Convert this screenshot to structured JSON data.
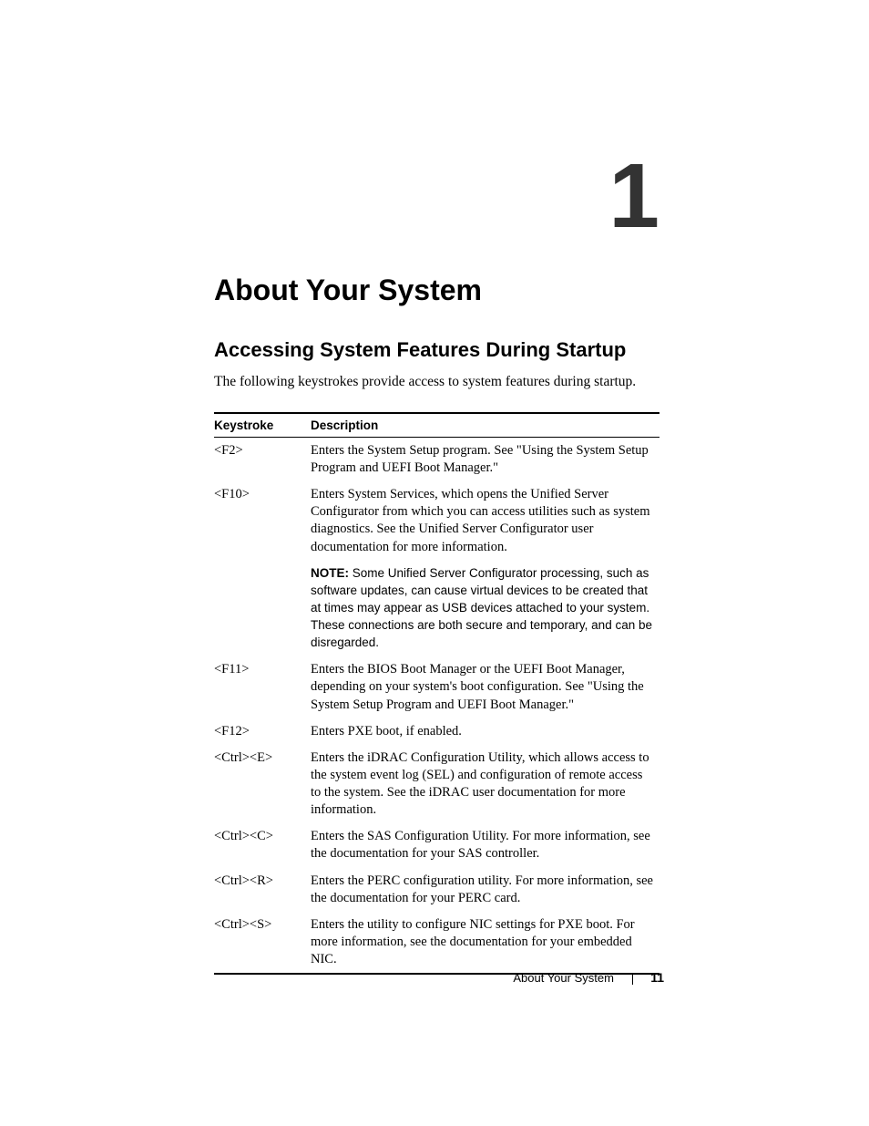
{
  "chapter_number": "1",
  "heading1": "About Your System",
  "heading2": "Accessing System Features During Startup",
  "intro": "The following keystrokes provide access to system features during startup.",
  "table": {
    "headers": {
      "col1": "Keystroke",
      "col2": "Description"
    },
    "rows": [
      {
        "key": "<F2>",
        "desc": "Enters the System Setup program. See \"Using the System Setup Program and UEFI Boot Manager.\""
      },
      {
        "key": "<F10>",
        "desc": "Enters System Services, which opens the Unified Server Configurator from which you can access utilities such as system diagnostics. See the Unified Server Configurator user documentation for more information."
      },
      {
        "key": "",
        "note_label": "NOTE:",
        "note_text": " Some Unified Server Configurator processing, such as software updates, can cause virtual devices to be created that at times may appear as USB devices attached to your system. These connections are both secure and temporary, and can be disregarded."
      },
      {
        "key": "<F11>",
        "desc": "Enters the BIOS Boot Manager or the UEFI Boot Manager, depending on your system's boot configuration. See \"Using the System Setup Program and UEFI Boot Manager.\""
      },
      {
        "key": "<F12>",
        "desc": "Enters PXE boot, if enabled."
      },
      {
        "key": "<Ctrl><E>",
        "desc": "Enters the iDRAC Configuration Utility, which allows access to the system event log (SEL) and configuration of remote access to the system. See the iDRAC user documentation for more information."
      },
      {
        "key": "<Ctrl><C>",
        "desc": "Enters the SAS Configuration Utility. For more information, see the documentation for your SAS controller."
      },
      {
        "key": "<Ctrl><R>",
        "desc": "Enters the PERC configuration utility. For more information, see the documentation for your PERC card."
      },
      {
        "key": "<Ctrl><S>",
        "desc": "Enters the utility to configure NIC settings for PXE boot. For more information, see the documentation for your embedded NIC."
      }
    ]
  },
  "footer": {
    "section": "About Your System",
    "page": "11"
  }
}
